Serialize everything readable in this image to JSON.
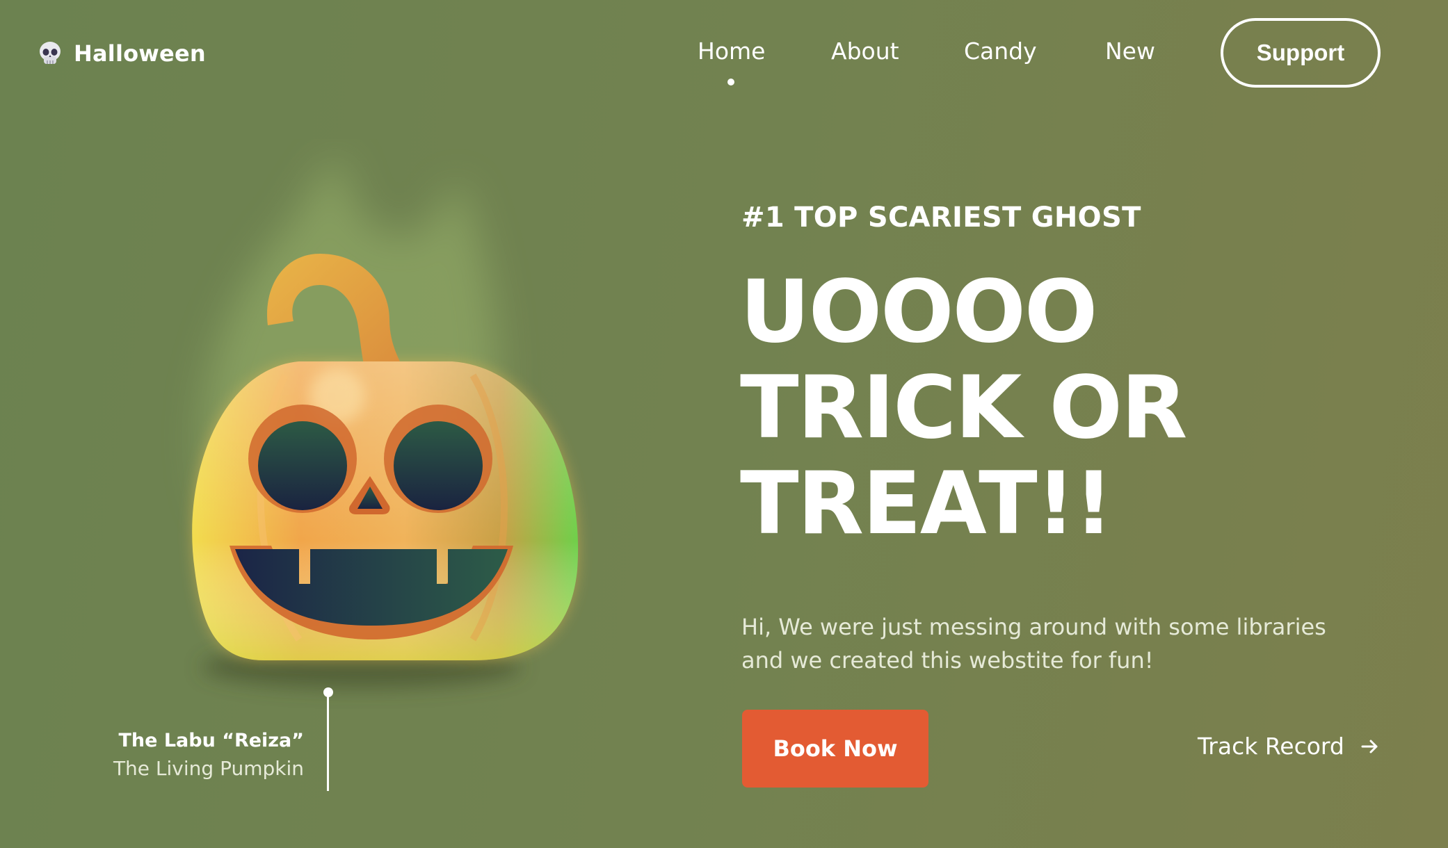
{
  "brand": {
    "name": "Halloween",
    "icon": "skull-icon"
  },
  "nav": {
    "items": [
      {
        "label": "Home",
        "active": true
      },
      {
        "label": "About",
        "active": false
      },
      {
        "label": "Candy",
        "active": false
      },
      {
        "label": "New",
        "active": false
      }
    ],
    "support_label": "Support"
  },
  "hero": {
    "eyebrow": "#1 TOP SCARIEST GHOST",
    "headline": [
      "UOOOO",
      "TRICK OR",
      "TREAT!!"
    ],
    "description": "Hi, We were just messing around with some libraries and we created this webstite for fun!",
    "primary_cta": "Book Now",
    "secondary_cta": "Track Record",
    "secondary_icon": "arrow-right-icon"
  },
  "character": {
    "name": "The Labu “Reiza”",
    "subtitle": "The Living Pumpkin",
    "image": "jack-o-lantern-icon"
  },
  "colors": {
    "background": "#728250",
    "accent": "#e35b33",
    "text": "#ffffff",
    "muted_text": "#e6ead8"
  }
}
